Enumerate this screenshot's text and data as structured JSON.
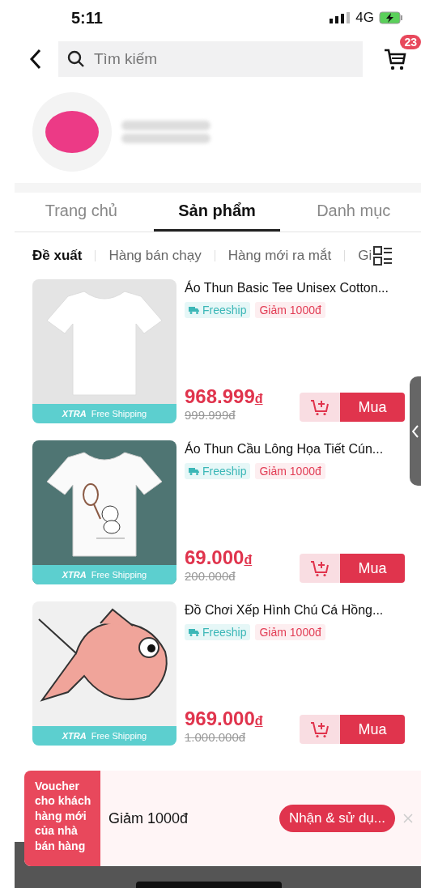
{
  "status_bar": {
    "time": "5:11",
    "network": "4G"
  },
  "header": {
    "search": {
      "placeholder": "Tìm kiếm"
    },
    "cart_count": "23"
  },
  "tabs": [
    {
      "label": "Trang chủ",
      "selected": false
    },
    {
      "label": "Sản phẩm",
      "selected": true
    },
    {
      "label": "Danh mục",
      "selected": false
    }
  ],
  "filters": [
    {
      "label": "Đề xuất",
      "selected": true
    },
    {
      "label": "Hàng bán chạy",
      "selected": false
    },
    {
      "label": "Hàng mới ra mắt",
      "selected": false
    },
    {
      "label": "Gi",
      "selected": false
    }
  ],
  "products": [
    {
      "title": "Áo Thun Basic Tee Unisex Cotton...",
      "tags": [
        {
          "kind": "freeship",
          "text": "Freeship"
        },
        {
          "kind": "discount",
          "text": "Giảm 1000đ"
        }
      ],
      "price": "968.999",
      "currency": "đ",
      "original_price": "999.999đ",
      "ship_brand": "XTRA",
      "ship_text": "Free Shipping",
      "buy": "Mua"
    },
    {
      "title": "Áo Thun Cầu Lông Họa Tiết Cún...",
      "tags": [
        {
          "kind": "freeship",
          "text": "Freeship"
        },
        {
          "kind": "discount",
          "text": "Giảm 1000đ"
        }
      ],
      "price": "69.000",
      "currency": "đ",
      "original_price": "200.000đ",
      "ship_brand": "XTRA",
      "ship_text": "Free Shipping",
      "buy": "Mua"
    },
    {
      "title": "Đồ Chơi Xếp Hình Chú Cá Hồng...",
      "tags": [
        {
          "kind": "freeship",
          "text": "Freeship"
        },
        {
          "kind": "discount",
          "text": "Giảm 1000đ"
        }
      ],
      "price": "969.000",
      "currency": "đ",
      "original_price": "1.000.000đ",
      "ship_brand": "XTRA",
      "ship_text": "Free Shipping",
      "buy": "Mua"
    }
  ],
  "voucher": {
    "label": "Voucher cho khách hàng mới của nhà bán hàng",
    "amount": "Giảm 1000đ",
    "button": "Nhận & sử dụ..."
  }
}
